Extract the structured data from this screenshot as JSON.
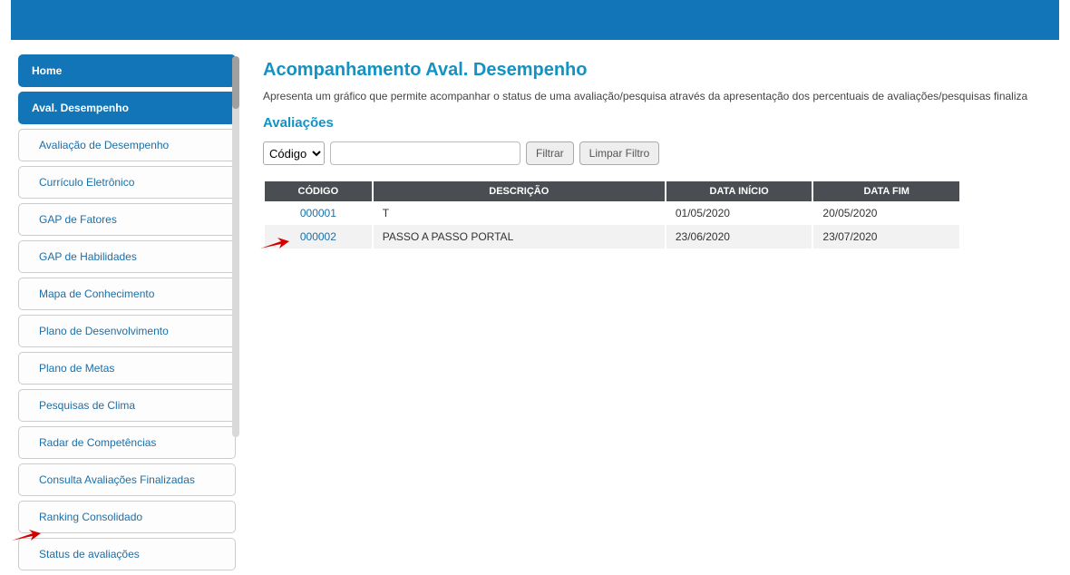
{
  "sidebar": {
    "items": [
      {
        "label": "Home",
        "primary": true
      },
      {
        "label": "Aval. Desempenho",
        "primary": true
      },
      {
        "label": "Avaliação de Desempenho"
      },
      {
        "label": "Currículo Eletrônico"
      },
      {
        "label": "GAP de Fatores"
      },
      {
        "label": "GAP de Habilidades"
      },
      {
        "label": "Mapa de Conhecimento"
      },
      {
        "label": "Plano de Desenvolvimento"
      },
      {
        "label": "Plano de Metas"
      },
      {
        "label": "Pesquisas de Clima"
      },
      {
        "label": "Radar de Competências"
      },
      {
        "label": "Consulta Avaliações Finalizadas"
      },
      {
        "label": "Ranking Consolidado"
      },
      {
        "label": "Status de avaliações"
      }
    ]
  },
  "page": {
    "title": "Acompanhamento Aval. Desempenho",
    "description": "Apresenta um gráfico que permite acompanhar o status de uma avaliação/pesquisa através da apresentação dos percentuais de avaliações/pesquisas finaliza",
    "section": "Avaliações"
  },
  "filter": {
    "select_value": "Código",
    "input_value": "",
    "btn_filter": "Filtrar",
    "btn_clear": "Limpar Filtro"
  },
  "table": {
    "headers": {
      "code": "CÓDIGO",
      "desc": "DESCRIÇÃO",
      "start": "DATA INÍCIO",
      "end": "DATA FIM"
    },
    "rows": [
      {
        "code": "000001",
        "desc": "T",
        "start": "01/05/2020",
        "end": "20/05/2020"
      },
      {
        "code": "000002",
        "desc": "PASSO A PASSO PORTAL",
        "start": "23/06/2020",
        "end": "23/07/2020"
      }
    ]
  }
}
